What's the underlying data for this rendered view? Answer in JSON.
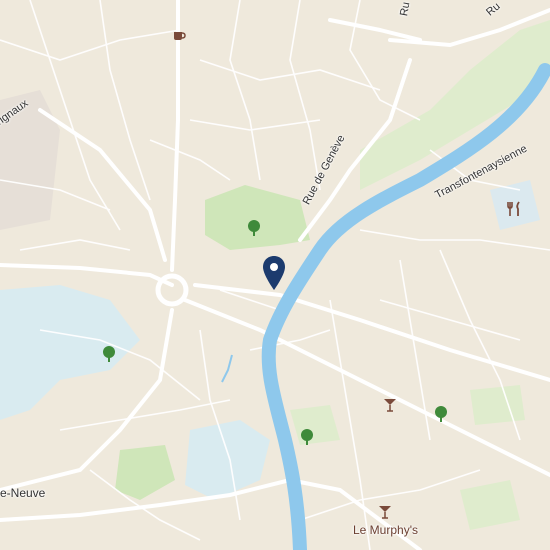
{
  "map": {
    "streets": {
      "rue_de_geneve": "Rue de Genève",
      "transfontenaysienne": "Transfontenaysienne",
      "rue_partial_top": "Ru",
      "rue_partial_top2": "Ru"
    },
    "places": {
      "vignaux_partial": "vignaux",
      "neuve_partial": "e-Neuve"
    },
    "pois": {
      "bar_le_murphys": "Le Murphy's"
    },
    "icons": {
      "cafe": "cafe-icon",
      "restaurant": "restaurant-icon",
      "bar": "bar-icon",
      "park": "park-tree-icon",
      "marker": "location-marker-icon"
    },
    "colors": {
      "background": "#efe9dc",
      "river": "#8ec8ec",
      "park": "#cfe6b9",
      "water_area": "#d9ebf0",
      "road": "#ffffff",
      "marker": "#1c3b6e",
      "poi": "#7a4a3a"
    }
  }
}
